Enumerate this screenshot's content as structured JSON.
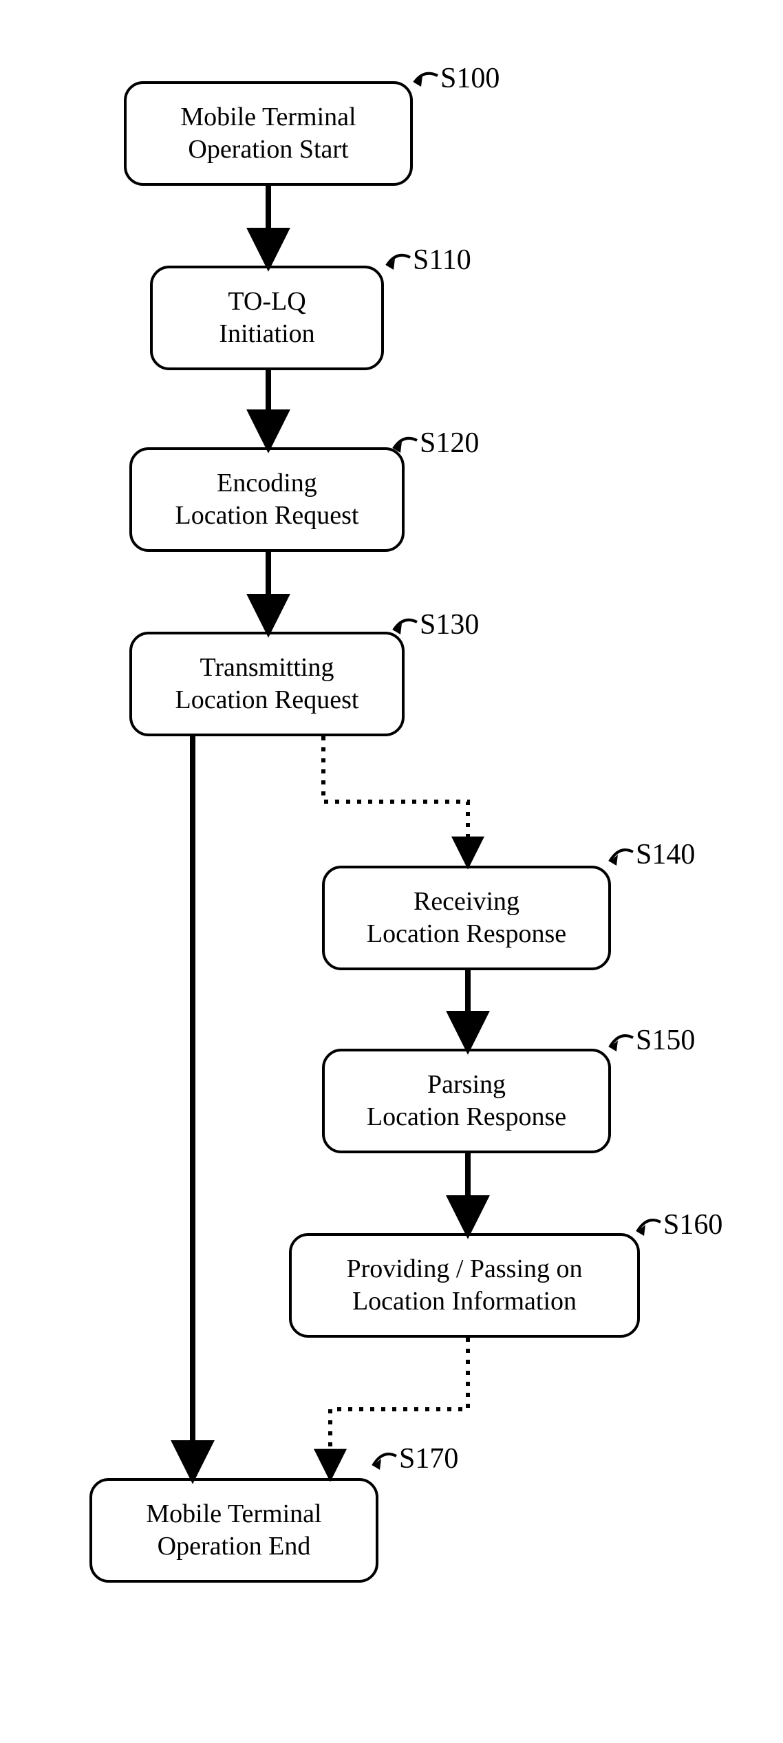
{
  "nodes": {
    "s100": {
      "label": "S100",
      "text": "Mobile Terminal\nOperation Start"
    },
    "s110": {
      "label": "S110",
      "text": "TO-LQ\nInitiation"
    },
    "s120": {
      "label": "S120",
      "text": "Encoding\nLocation Request"
    },
    "s130": {
      "label": "S130",
      "text": "Transmitting\nLocation Request"
    },
    "s140": {
      "label": "S140",
      "text": "Receiving\nLocation Response"
    },
    "s150": {
      "label": "S150",
      "text": "Parsing\nLocation Response"
    },
    "s160": {
      "label": "S160",
      "text": "Providing / Passing on\nLocation Information"
    },
    "s170": {
      "label": "S170",
      "text": "Mobile Terminal\nOperation End"
    }
  }
}
